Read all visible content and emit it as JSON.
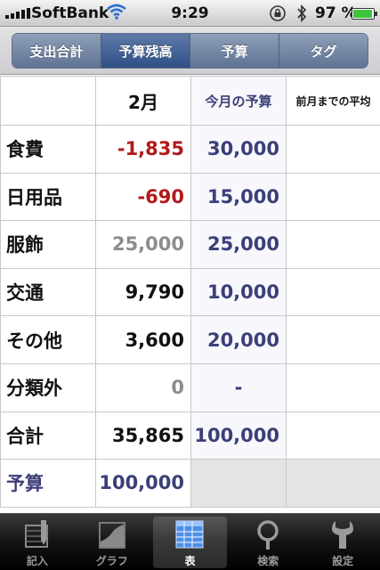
{
  "status_bar": {
    "carrier": "SoftBank",
    "time": "9:29",
    "battery_percent": "97 %",
    "battery_level": 0.97
  },
  "segments": [
    {
      "label": "支出合計",
      "active": false
    },
    {
      "label": "予算残高",
      "active": true
    },
    {
      "label": "予算",
      "active": false
    },
    {
      "label": "タグ",
      "active": false
    }
  ],
  "table": {
    "header": {
      "corner": "",
      "month": "2月",
      "budget_col": "今月の予算",
      "avg_col": "前月までの平均"
    },
    "rows": [
      {
        "category": "食費",
        "remaining": "-1,835",
        "budget": "30,000",
        "avg": "",
        "style": "neg"
      },
      {
        "category": "日用品",
        "remaining": "-690",
        "budget": "15,000",
        "avg": "",
        "style": "neg"
      },
      {
        "category": "服飾",
        "remaining": "25,000",
        "budget": "25,000",
        "avg": "",
        "style": "over"
      },
      {
        "category": "交通",
        "remaining": "9,790",
        "budget": "10,000",
        "avg": "",
        "style": "pos"
      },
      {
        "category": "その他",
        "remaining": "3,600",
        "budget": "20,000",
        "avg": "",
        "style": "pos"
      },
      {
        "category": "分類外",
        "remaining": "0",
        "budget": "-",
        "avg": "",
        "style": "zero"
      },
      {
        "category": "合計",
        "remaining": "35,865",
        "budget": "100,000",
        "avg": "",
        "style": "pos"
      }
    ],
    "footer": {
      "label": "予算",
      "value": "100,000"
    }
  },
  "tab_bar": [
    {
      "label": "記入",
      "icon": "pencil-icon",
      "active": false
    },
    {
      "label": "グラフ",
      "icon": "graph-icon",
      "active": false
    },
    {
      "label": "表",
      "icon": "table-icon",
      "active": true
    },
    {
      "label": "検索",
      "icon": "search-icon",
      "active": false
    },
    {
      "label": "設定",
      "icon": "wrench-icon",
      "active": false
    }
  ],
  "colors": {
    "accent": "#2f4f86",
    "negative": "#b21a1a",
    "budget_text": "#3b3f78",
    "battery": "#3cc53c"
  }
}
